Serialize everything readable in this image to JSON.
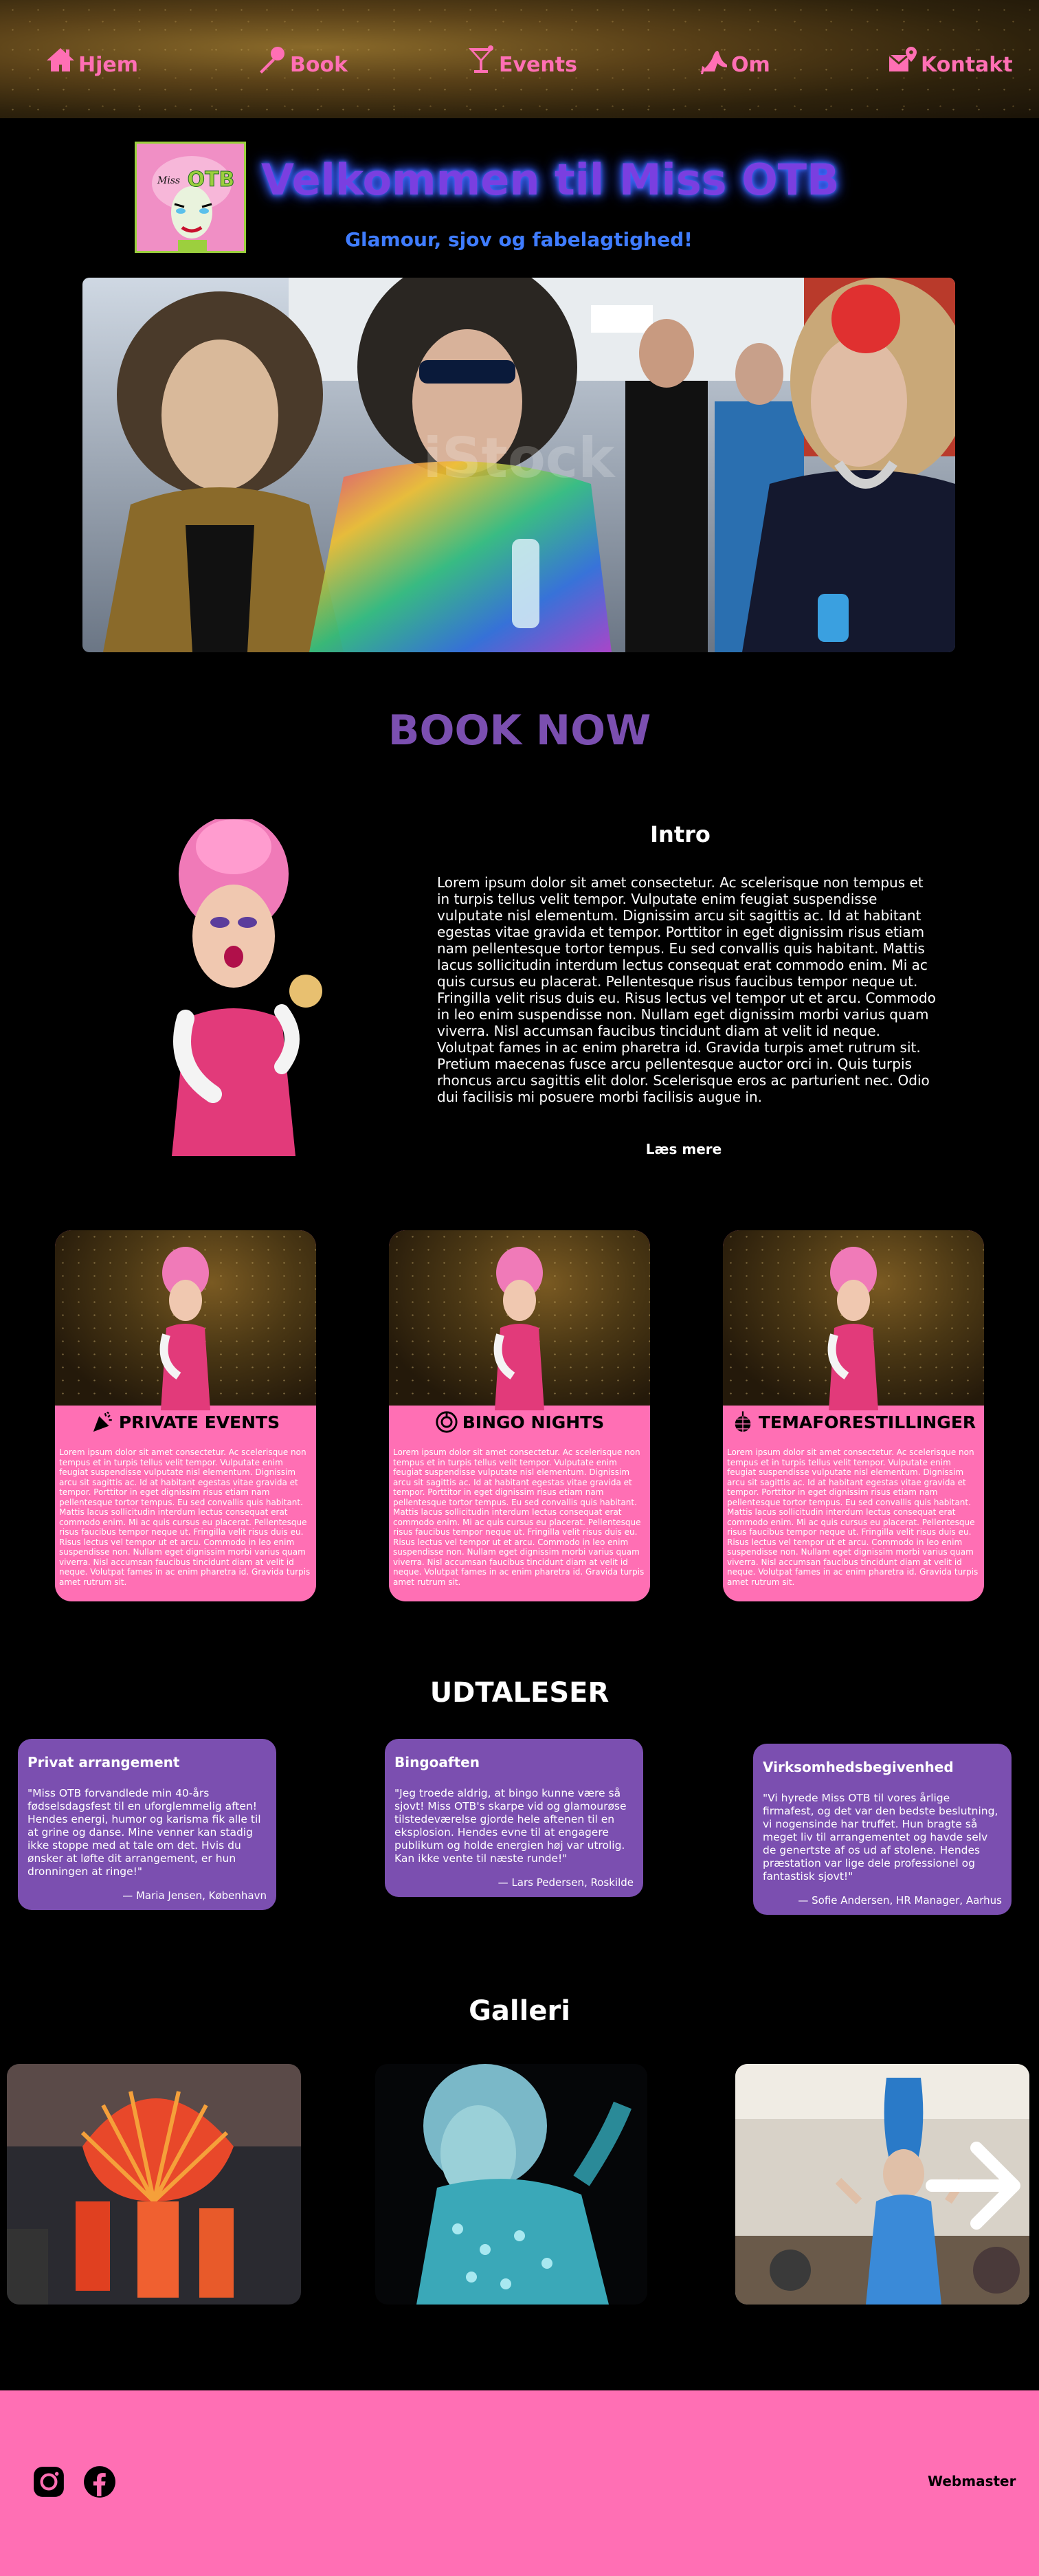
{
  "nav": {
    "items": [
      {
        "label": "Hjem",
        "icon": "house-icon"
      },
      {
        "label": "Book",
        "icon": "microphone-icon"
      },
      {
        "label": "Events",
        "icon": "cocktail-icon"
      },
      {
        "label": "Om",
        "icon": "high-heel-icon"
      },
      {
        "label": "Kontakt",
        "icon": "envelope-pin-icon"
      }
    ],
    "color": "#ff6fb4"
  },
  "header": {
    "logo_text": "OTB",
    "logo_script": "Miss",
    "title": "Velkommen til Miss OTB",
    "subtitle": "Glamour, sjov og fabelagtighed!"
  },
  "hero": {
    "watermark": "iStock"
  },
  "book_now": "BOOK NOW",
  "intro": {
    "title": "Intro",
    "text": "Lorem ipsum dolor sit amet consectetur. Ac scelerisque non tempus et in turpis tellus velit tempor. Vulputate enim feugiat suspendisse vulputate nisl elementum. Dignissim arcu sit sagittis ac. Id at habitant egestas vitae gravida et tempor. Porttitor in eget dignissim risus etiam nam pellentesque tortor tempus. Eu sed convallis quis habitant. Mattis lacus sollicitudin interdum lectus consequat erat commodo enim. Mi ac quis cursus eu placerat. Pellentesque risus faucibus tempor neque ut. Fringilla velit risus duis eu. Risus lectus vel tempor ut et arcu. Commodo in leo enim suspendisse non. Nullam eget dignissim morbi varius quam viverra. Nisl accumsan faucibus tincidunt diam at velit id neque. Volutpat fames in ac enim pharetra id. Gravida turpis amet rutrum sit. Pretium maecenas fusce arcu pellentesque auctor orci in. Quis turpis rhoncus arcu sagittis elit dolor. Scelerisque eros ac parturient nec. Odio dui facilisis mi posuere morbi facilisis augue in.",
    "read_more": "Læs mere"
  },
  "services": [
    {
      "title": "PRIVATE EVENTS",
      "icon": "party-popper-icon",
      "text": "Lorem ipsum dolor sit amet consectetur. Ac scelerisque non tempus et in turpis tellus velit tempor. Vulputate enim feugiat suspendisse vulputate nisl elementum. Dignissim arcu sit sagittis ac. Id at habitant egestas vitae gravida et tempor. Porttitor in eget dignissim risus etiam nam pellentesque tortor tempus. Eu sed convallis quis habitant. Mattis lacus sollicitudin interdum lectus consequat erat commodo enim. Mi ac quis cursus eu placerat. Pellentesque risus faucibus tempor neque ut. Fringilla velit risus duis eu. Risus lectus vel tempor ut et arcu. Commodo in leo enim suspendisse non. Nullam eget dignissim morbi varius quam viverra. Nisl accumsan faucibus tincidunt diam at velit id neque. Volutpat fames in ac enim pharetra id. Gravida turpis amet rutrum sit."
    },
    {
      "title": "BINGO NIGHTS",
      "icon": "bingo-ball-icon",
      "text": "Lorem ipsum dolor sit amet consectetur. Ac scelerisque non tempus et in turpis tellus velit tempor. Vulputate enim feugiat suspendisse vulputate nisl elementum. Dignissim arcu sit sagittis ac. Id at habitant egestas vitae gravida et tempor. Porttitor in eget dignissim risus etiam nam pellentesque tortor tempus. Eu sed convallis quis habitant. Mattis lacus sollicitudin interdum lectus consequat erat commodo enim. Mi ac quis cursus eu placerat. Pellentesque risus faucibus tempor neque ut. Fringilla velit risus duis eu. Risus lectus vel tempor ut et arcu. Commodo in leo enim suspendisse non. Nullam eget dignissim morbi varius quam viverra. Nisl accumsan faucibus tincidunt diam at velit id neque. Volutpat fames in ac enim pharetra id. Gravida turpis amet rutrum sit."
    },
    {
      "title": "TEMAFORESTILLINGER",
      "icon": "disco-ball-icon",
      "text": "Lorem ipsum dolor sit amet consectetur. Ac scelerisque non tempus et in turpis tellus velit tempor. Vulputate enim feugiat suspendisse vulputate nisl elementum. Dignissim arcu sit sagittis ac. Id at habitant egestas vitae gravida et tempor. Porttitor in eget dignissim risus etiam nam pellentesque tortor tempus. Eu sed convallis quis habitant. Mattis lacus sollicitudin interdum lectus consequat erat commodo enim. Mi ac quis cursus eu placerat. Pellentesque risus faucibus tempor neque ut. Fringilla velit risus duis eu. Risus lectus vel tempor ut et arcu. Commodo in leo enim suspendisse non. Nullam eget dignissim morbi varius quam viverra. Nisl accumsan faucibus tincidunt diam at velit id neque. Volutpat fames in ac enim pharetra id. Gravida turpis amet rutrum sit."
    }
  ],
  "testimonials": {
    "title": "UDTALESER",
    "items": [
      {
        "heading": "Privat arrangement",
        "quote": "\"Miss OTB forvandlede min 40-års fødselsdagsfest til en uforglemmelig aften! Hendes energi, humor og karisma fik alle til at grine og danse. Mine venner kan stadig ikke stoppe med at tale om det. Hvis du ønsker at løfte dit arrangement, er hun dronningen at ringe!\"",
        "author": "— Maria Jensen, København"
      },
      {
        "heading": "Bingoaften",
        "quote": "\"Jeg troede aldrig, at bingo kunne være så sjovt! Miss OTB's skarpe vid og glamourøse tilstedeværelse gjorde hele aftenen til en eksplosion. Hendes evne til at engagere publikum og holde energien høj var utrolig. Kan ikke vente til næste runde!\"",
        "author": "— Lars Pedersen, Roskilde"
      },
      {
        "heading": "Virksomhedsbegivenhed",
        "quote": "\"Vi hyrede Miss OTB til vores årlige firmafest, og det var den bedste beslutning, vi nogensinde har truffet. Hun bragte så meget liv til arrangementet og havde selv de genertste af os ud af stolene. Hendes præstation var lige dele professionel og fantastisk sjovt!\"",
        "author": "— Sofie Andersen, HR Manager, Aarhus"
      }
    ],
    "card_color": "#7b4fb0"
  },
  "gallery": {
    "title": "Galleri",
    "images": [
      "parade-float-photo",
      "blue-sequin-queen-photo",
      "blue-wig-queen-photo"
    ]
  },
  "footer": {
    "social": [
      "instagram-icon",
      "facebook-icon"
    ],
    "webmaster": "Webmaster",
    "color": "#ff6fb4"
  }
}
